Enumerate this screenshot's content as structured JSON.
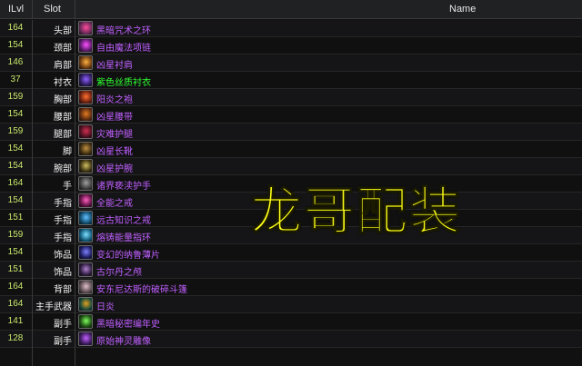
{
  "header": {
    "ilvl": "ILvl",
    "slot": "Slot",
    "name": "Name"
  },
  "colors": {
    "ilvl": "#c8e86a",
    "epic": "#c060ff",
    "uncommon": "#30ff30"
  },
  "rows": [
    {
      "ilvl": "164",
      "slot": "头部",
      "name": "黑暗咒术之环",
      "quality": "epic",
      "icon": "dark-ring-icon",
      "c1": "#6a2a5a",
      "c2": "#ff4a9a"
    },
    {
      "ilvl": "154",
      "slot": "颈部",
      "name": "自由魔法项链",
      "quality": "epic",
      "icon": "necklace-icon",
      "c1": "#5a1a6a",
      "c2": "#ff50ff"
    },
    {
      "ilvl": "146",
      "slot": "肩部",
      "name": "凶星衬肩",
      "quality": "epic",
      "icon": "shoulder-icon",
      "c1": "#6a3a10",
      "c2": "#ffb040"
    },
    {
      "ilvl": "37",
      "slot": "衬衣",
      "name": "紫色丝质衬衣",
      "quality": "uncommon",
      "icon": "shirt-icon",
      "c1": "#2a1a5a",
      "c2": "#9060ff"
    },
    {
      "ilvl": "159",
      "slot": "胸部",
      "name": "阳炎之袍",
      "quality": "epic",
      "icon": "robe-icon",
      "c1": "#6a2010",
      "c2": "#ff7030"
    },
    {
      "ilvl": "154",
      "slot": "腰部",
      "name": "凶星腰带",
      "quality": "epic",
      "icon": "belt-icon",
      "c1": "#5a2a10",
      "c2": "#e07a20"
    },
    {
      "ilvl": "159",
      "slot": "腿部",
      "name": "灾难护腿",
      "quality": "epic",
      "icon": "legs-icon",
      "c1": "#4a1020",
      "c2": "#d03050"
    },
    {
      "ilvl": "154",
      "slot": "脚",
      "name": "凶星长靴",
      "quality": "epic",
      "icon": "boots-icon",
      "c1": "#3a2a10",
      "c2": "#c09040"
    },
    {
      "ilvl": "154",
      "slot": "腕部",
      "name": "凶星护腕",
      "quality": "epic",
      "icon": "bracer-icon",
      "c1": "#3a3010",
      "c2": "#d0c060"
    },
    {
      "ilvl": "164",
      "slot": "手",
      "name": "诸界亵渎护手",
      "quality": "epic",
      "icon": "gloves-icon",
      "c1": "#3a3a3a",
      "c2": "#a0a0a0"
    },
    {
      "ilvl": "154",
      "slot": "手指",
      "name": "全能之戒",
      "quality": "epic",
      "icon": "ring-icon",
      "c1": "#5a1040",
      "c2": "#ff60c0"
    },
    {
      "ilvl": "151",
      "slot": "手指",
      "name": "远古知识之戒",
      "quality": "epic",
      "icon": "ring-icon",
      "c1": "#104a6a",
      "c2": "#60c0ff"
    },
    {
      "ilvl": "159",
      "slot": "手指",
      "name": "熔铸能量指环",
      "quality": "epic",
      "icon": "ring-icon",
      "c1": "#105a7a",
      "c2": "#80e0ff"
    },
    {
      "ilvl": "154",
      "slot": "饰品",
      "name": "变幻的纳鲁薄片",
      "quality": "epic",
      "icon": "trinket-icon",
      "c1": "#1a1a5a",
      "c2": "#8080ff"
    },
    {
      "ilvl": "151",
      "slot": "饰品",
      "name": "古尔丹之颅",
      "quality": "epic",
      "icon": "skull-icon",
      "c1": "#2a1a3a",
      "c2": "#b080d0"
    },
    {
      "ilvl": "164",
      "slot": "背部",
      "name": "安东尼达斯的破碎斗篷",
      "quality": "epic",
      "icon": "cloak-icon",
      "c1": "#5a4a50",
      "c2": "#e0c0c8"
    },
    {
      "ilvl": "164",
      "slot": "主手武器",
      "name": "日炎",
      "quality": "epic",
      "icon": "staff-icon",
      "c1": "#1a4a3a",
      "c2": "#e0a020"
    },
    {
      "ilvl": "141",
      "slot": "副手",
      "name": "黑暗秘密编年史",
      "quality": "epic",
      "icon": "book-icon",
      "c1": "#1a4a10",
      "c2": "#80ff60"
    },
    {
      "ilvl": "128",
      "slot": "副手",
      "name": "原始神灵雕像",
      "quality": "epic",
      "icon": "idol-icon",
      "c1": "#3a1a5a",
      "c2": "#c060ff"
    }
  ],
  "watermark": "龙哥配装"
}
